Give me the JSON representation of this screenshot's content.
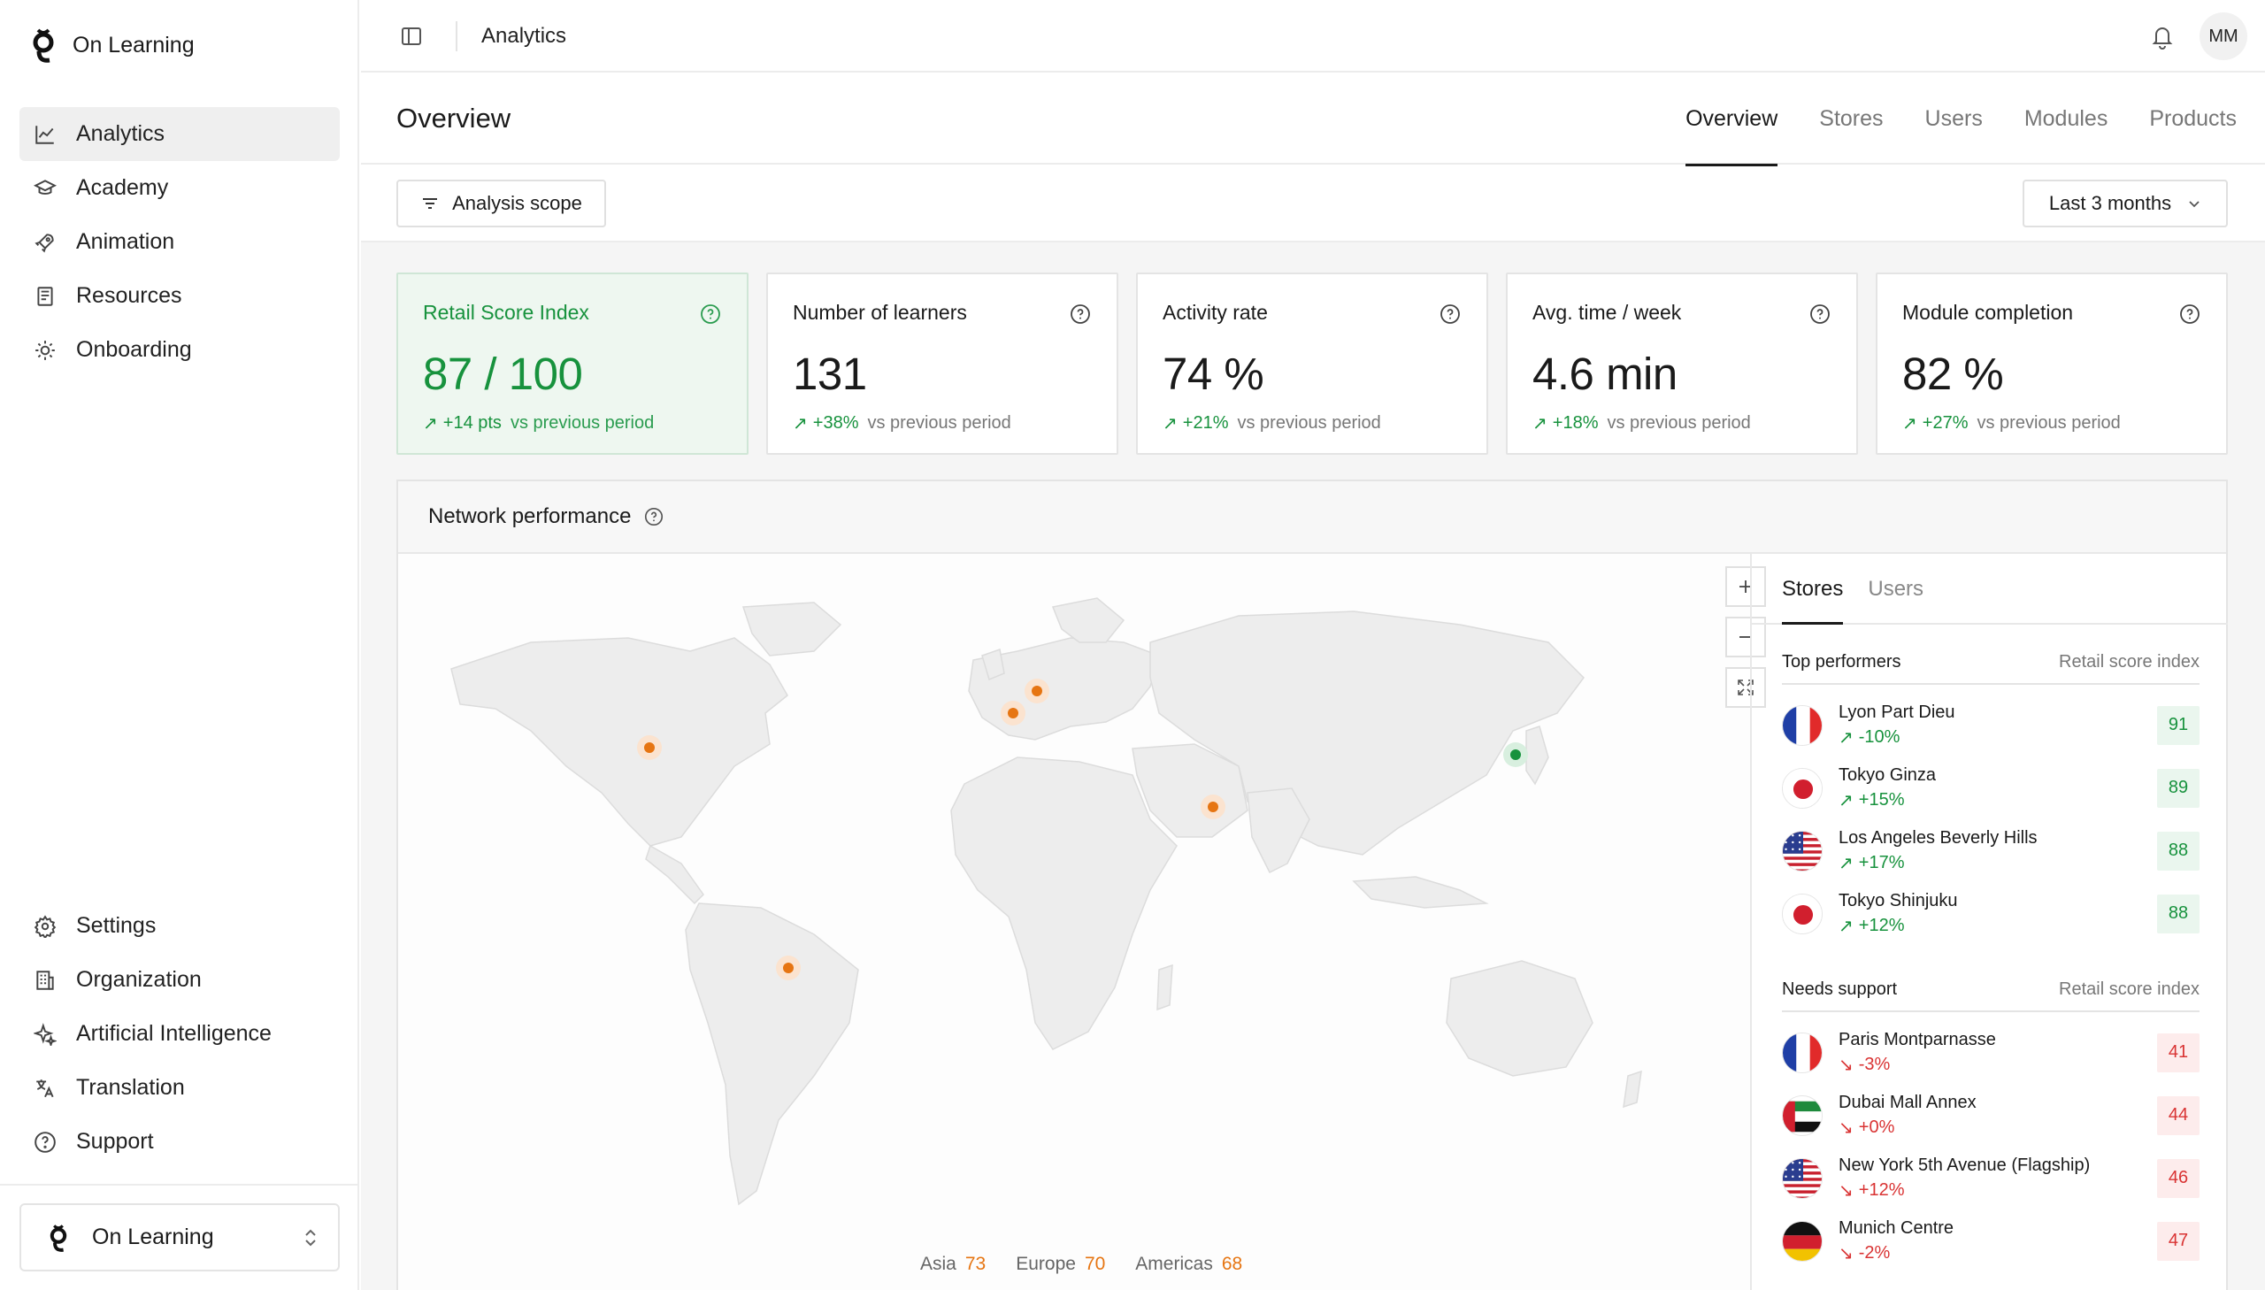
{
  "brand": {
    "name": "On Learning"
  },
  "sidebar": {
    "top_items": [
      {
        "label": "Analytics",
        "icon": "chart-line-icon",
        "active": true
      },
      {
        "label": "Academy",
        "icon": "graduation-cap-icon"
      },
      {
        "label": "Animation",
        "icon": "rocket-icon"
      },
      {
        "label": "Resources",
        "icon": "book-icon"
      },
      {
        "label": "Onboarding",
        "icon": "sun-icon"
      }
    ],
    "bottom_items": [
      {
        "label": "Settings",
        "icon": "gear-icon"
      },
      {
        "label": "Organization",
        "icon": "building-icon"
      },
      {
        "label": "Artificial Intelligence",
        "icon": "sparkles-icon"
      },
      {
        "label": "Translation",
        "icon": "translate-icon"
      },
      {
        "label": "Support",
        "icon": "help-circle-icon"
      }
    ],
    "org_switcher": "On Learning"
  },
  "topbar": {
    "title": "Analytics",
    "avatar_initials": "MM"
  },
  "header": {
    "title": "Overview",
    "tabs": [
      "Overview",
      "Stores",
      "Users",
      "Modules",
      "Products"
    ],
    "active_tab": "Overview"
  },
  "filters": {
    "scope_label": "Analysis scope",
    "range_label": "Last 3 months"
  },
  "kpis": [
    {
      "label": "Retail Score Index",
      "value": "87 / 100",
      "delta": "+14 pts",
      "vs": "vs previous period"
    },
    {
      "label": "Number of learners",
      "value": "131",
      "delta": "+38%",
      "vs": "vs previous period"
    },
    {
      "label": "Activity rate",
      "value": "74 %",
      "delta": "+21%",
      "vs": "vs previous period"
    },
    {
      "label": "Avg. time / week",
      "value": "4.6 min",
      "delta": "+18%",
      "vs": "vs previous period"
    },
    {
      "label": "Module completion",
      "value": "82 %",
      "delta": "+27%",
      "vs": "vs previous period"
    }
  ],
  "network": {
    "title": "Network performance",
    "legend": [
      {
        "region": "Asia",
        "value": "73"
      },
      {
        "region": "Europe",
        "value": "70"
      },
      {
        "region": "Americas",
        "value": "68"
      }
    ],
    "panel_tabs": [
      "Stores",
      "Users"
    ],
    "top": {
      "title": "Top performers",
      "metric": "Retail score index",
      "rows": [
        {
          "name": "Lyon Part Dieu",
          "delta": "-10%",
          "score": "91",
          "flag": "fr"
        },
        {
          "name": "Tokyo Ginza",
          "delta": "+15%",
          "score": "89",
          "flag": "jp"
        },
        {
          "name": "Los Angeles Beverly Hills",
          "delta": "+17%",
          "score": "88",
          "flag": "us"
        },
        {
          "name": "Tokyo Shinjuku",
          "delta": "+12%",
          "score": "88",
          "flag": "jp"
        }
      ]
    },
    "support": {
      "title": "Needs support",
      "metric": "Retail score index",
      "rows": [
        {
          "name": "Paris Montparnasse",
          "delta": "-3%",
          "score": "41",
          "flag": "fr"
        },
        {
          "name": "Dubai Mall Annex",
          "delta": "+0%",
          "score": "44",
          "flag": "ae"
        },
        {
          "name": "New York 5th Avenue (Flagship)",
          "delta": "+12%",
          "score": "46",
          "flag": "us"
        },
        {
          "name": "Munich Centre",
          "delta": "-2%",
          "score": "47",
          "flag": "de"
        }
      ]
    },
    "colors": {
      "positive": "#17923d",
      "negative": "#d93333",
      "marker": "#e67512"
    }
  }
}
